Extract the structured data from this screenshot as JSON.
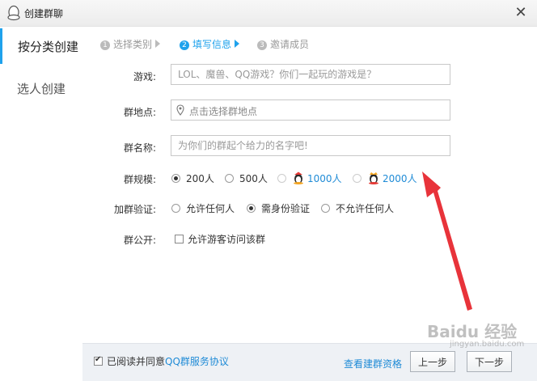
{
  "window": {
    "title": "创建群聊",
    "close_glyph": "✕"
  },
  "sidebar": {
    "items": [
      {
        "label": "按分类创建"
      },
      {
        "label": "选人创建"
      }
    ]
  },
  "steps": [
    {
      "num": "1",
      "label": "选择类别"
    },
    {
      "num": "2",
      "label": "填写信息"
    },
    {
      "num": "3",
      "label": "邀请成员"
    }
  ],
  "form": {
    "game": {
      "label": "游戏:",
      "placeholder": "LOL、魔兽、QQ游戏？你们一起玩的游戏是？"
    },
    "location": {
      "label": "群地点:",
      "placeholder": "点击选择群地点"
    },
    "name": {
      "label": "群名称:",
      "placeholder": "为你们的群起个给力的名字吧!"
    },
    "size": {
      "label": "群规模:",
      "options": [
        "200人",
        "500人",
        "1000人",
        "2000人"
      ],
      "selected": "200人"
    },
    "verify": {
      "label": "加群验证:",
      "options": [
        "允许任何人",
        "需身份验证",
        "不允许任何人"
      ],
      "selected": "需身份验证"
    },
    "public": {
      "label": "群公开:",
      "checkbox_label": "允许游客访问该群",
      "checked": false
    }
  },
  "footer": {
    "agree_text": "已阅读并同意",
    "agree_link": "QQ群服务协议",
    "agree_checked": true,
    "view_link": "查看建群资格",
    "prev_label": "上一步",
    "next_label": "下一步"
  },
  "watermark": {
    "text": "Baidu 经验",
    "subtext": "jingyan.baidu.com"
  },
  "colors": {
    "accent": "#1fa2ec",
    "link": "#1f8bd6",
    "annotation_arrow": "#e8333a"
  }
}
